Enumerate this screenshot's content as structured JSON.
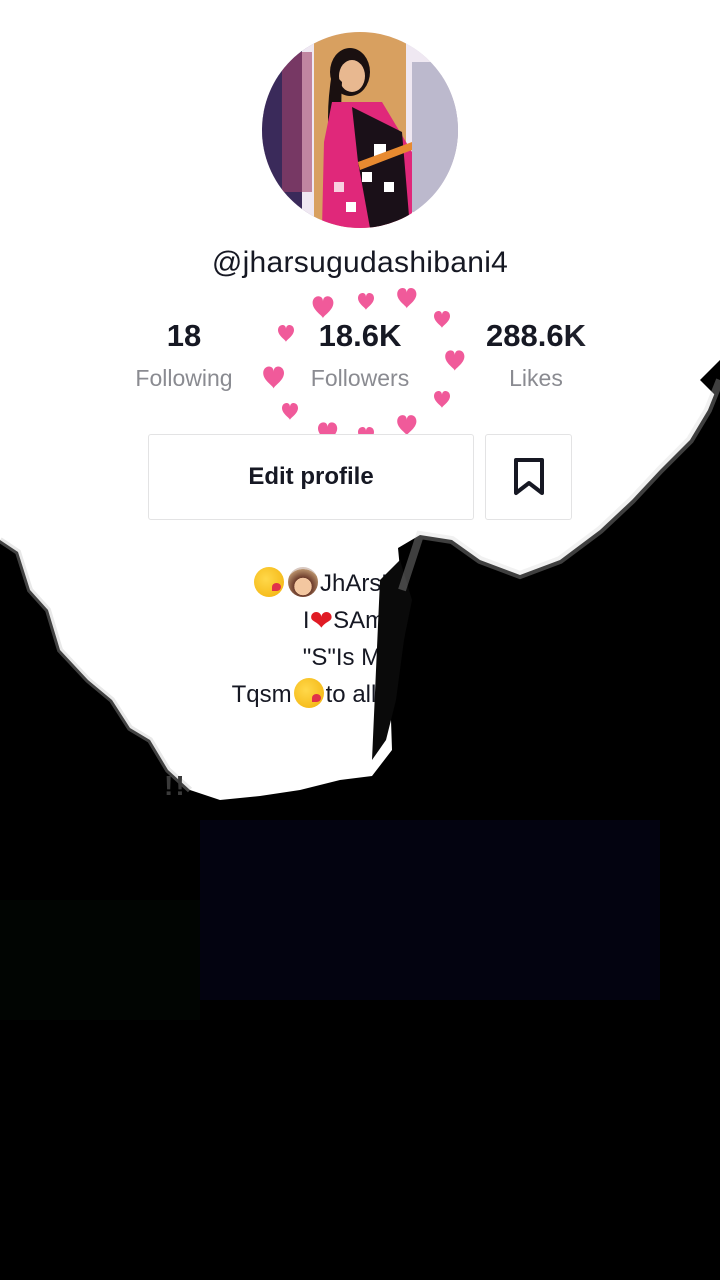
{
  "profile": {
    "username": "@jharsugudashibani4",
    "avatar_icon": "profile-photo"
  },
  "stats": [
    {
      "value": "18",
      "label": "Following"
    },
    {
      "value": "18.6K",
      "label": "Followers"
    },
    {
      "value": "288.6K",
      "label": "Likes"
    }
  ],
  "actions": {
    "edit_profile_label": "Edit profile",
    "bookmark_icon": "bookmark-icon"
  },
  "bio": {
    "line1_text": "JhArsUguDiA",
    "line2_prefix": "I",
    "line2_text": "SAmB",
    "line3_text": "\"S\"Is My L",
    "line4_prefix": "Tqsm",
    "line4_text": "to all"
  },
  "overlay": {
    "faint_text": "!!"
  },
  "colors": {
    "heart_pink": "#f05a9a",
    "text_primary": "#161823",
    "text_secondary": "#8a8b91"
  }
}
